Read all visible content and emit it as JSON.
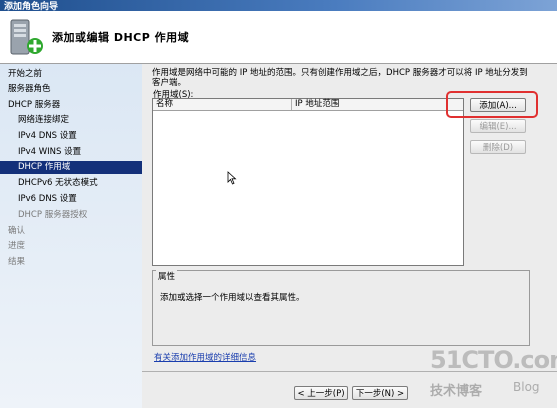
{
  "window": {
    "title": "添加角色向导"
  },
  "header": {
    "title": "添加或编辑 DHCP 作用域"
  },
  "nav": {
    "items": [
      {
        "label": "开始之前",
        "state": "normal"
      },
      {
        "label": "服务器角色",
        "state": "normal"
      },
      {
        "label": "DHCP 服务器",
        "state": "normal"
      },
      {
        "label": "网络连接绑定",
        "state": "normal"
      },
      {
        "label": "IPv4 DNS 设置",
        "state": "normal"
      },
      {
        "label": "IPv4 WINS 设置",
        "state": "normal"
      },
      {
        "label": "DHCP 作用域",
        "state": "active"
      },
      {
        "label": "DHCPv6 无状态模式",
        "state": "normal"
      },
      {
        "label": "IPv6 DNS 设置",
        "state": "normal"
      },
      {
        "label": "DHCP 服务器授权",
        "state": "dim"
      },
      {
        "label": "确认",
        "state": "dim"
      },
      {
        "label": "进度",
        "state": "dim"
      },
      {
        "label": "结果",
        "state": "dim"
      }
    ]
  },
  "main": {
    "description": "作用域是网络中可能的 IP 地址的范围。只有创建作用域之后，DHCP 服务器才可以将 IP 地址分发到客户端。",
    "scopes_label": "作用域(S):",
    "columns": [
      "名称",
      "IP 地址范围"
    ],
    "buttons": {
      "add": "添加(A)...",
      "edit": "编辑(E)...",
      "delete": "删除(D)"
    },
    "properties_title": "属性",
    "properties_text": "添加或选择一个作用域以查看其属性。",
    "help_link": "有关添加作用域的详细信息"
  },
  "footer": {
    "prev": "< 上一步(P)",
    "next": "下一步(N) >"
  },
  "watermark": {
    "site": "51CTO.com",
    "blog_cn": "技术博客",
    "blog_en": "Blog"
  },
  "colors": {
    "title_bar": "#1f4f8e",
    "nav_active": "#13307a",
    "highlight": "#e03030",
    "link": "#1a3eae"
  }
}
